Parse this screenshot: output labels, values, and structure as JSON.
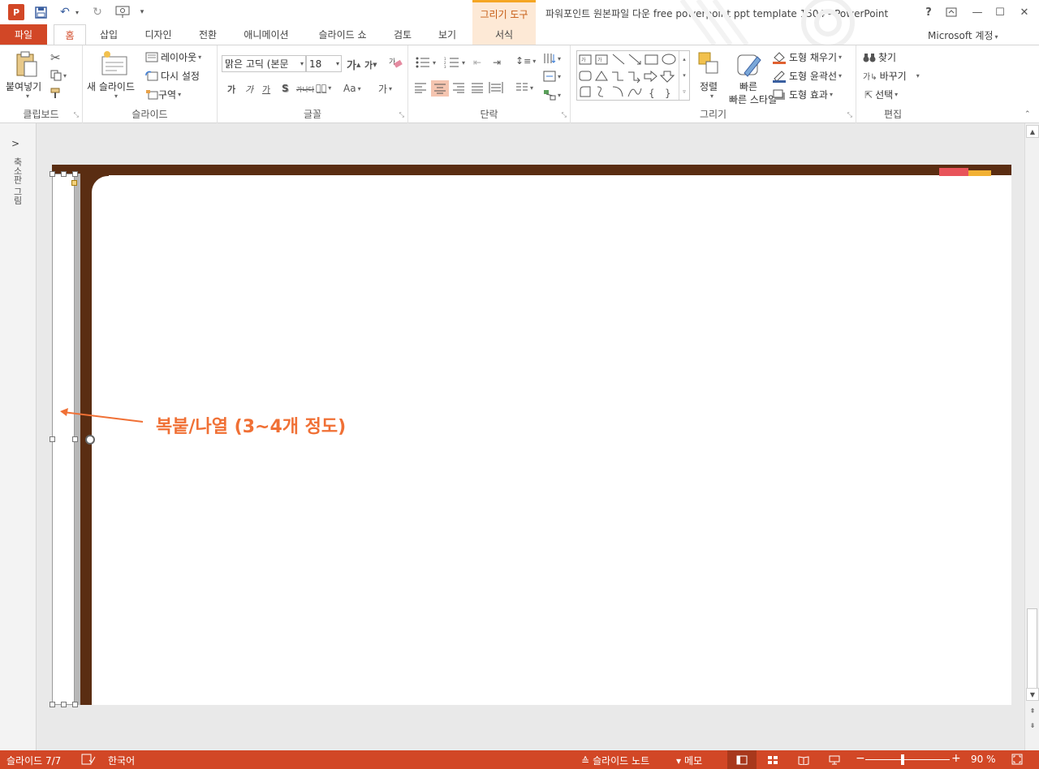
{
  "titlebar": {
    "app_icon": "P",
    "contextual_group": "그리기 도구",
    "title": "파워포인트 원본파일 다운 free powerpoint ppt template 1504 - PowerPoint",
    "help": "?",
    "minimize": "—",
    "maximize": "☐",
    "close": "✕"
  },
  "tabs": {
    "file": "파일",
    "home": "홈",
    "insert": "삽입",
    "design": "디자인",
    "transitions": "전환",
    "animations": "애니메이션",
    "slideshow": "슬라이드 쇼",
    "review": "검토",
    "view": "보기",
    "format": "서식",
    "account": "Microsoft 계정"
  },
  "ribbon": {
    "clipboard": {
      "label": "클립보드",
      "paste": "붙여넣기"
    },
    "slides": {
      "label": "슬라이드",
      "new_slide": "새 슬라이드",
      "layout": "레이아웃",
      "reset": "다시 설정",
      "section": "구역"
    },
    "font": {
      "label": "글꼴",
      "font_name": "맑은 고딕 (본문",
      "font_size": "18"
    },
    "paragraph": {
      "label": "단락"
    },
    "drawing": {
      "label": "그리기",
      "arrange": "정렬",
      "quick_styles": "빠른 스타일",
      "fill": "도형 채우기",
      "outline": "도형 윤곽선",
      "effects": "도형 효과"
    },
    "editing": {
      "label": "편집",
      "find": "찾기",
      "replace": "바꾸기",
      "select": "선택"
    }
  },
  "thumbnails": {
    "label": "축소판 그림"
  },
  "slide": {
    "annotation": "복붙/나열 (3~4개 정도)"
  },
  "statusbar": {
    "slide_index": "슬라이드 7/7",
    "language": "한국어",
    "notes": "슬라이드 노트",
    "comments": "메모",
    "zoom": "90 %"
  },
  "colors": {
    "accent": "#d24726",
    "slide_bar": "#5a2d12",
    "annotation": "#f07035",
    "tab_red": "#e8545a",
    "tab_yellow": "#f2b134"
  }
}
